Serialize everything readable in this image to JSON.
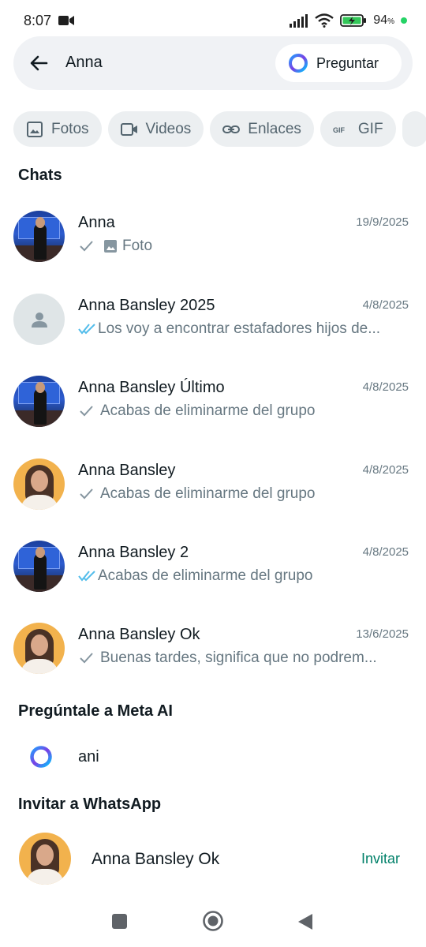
{
  "status_bar": {
    "time": "8:07",
    "battery_percent": "94",
    "battery_unit": "%"
  },
  "search": {
    "query": "Anna",
    "ask_button": "Preguntar"
  },
  "filters": [
    {
      "label": "Fotos",
      "icon": "photo-icon"
    },
    {
      "label": "Videos",
      "icon": "video-icon"
    },
    {
      "label": "Enlaces",
      "icon": "link-icon"
    },
    {
      "label": "GIF",
      "icon": "gif-icon"
    }
  ],
  "chats_section": {
    "title": "Chats",
    "items": [
      {
        "name": "Anna",
        "date": "19/9/2025",
        "preview": "Foto",
        "tick": "single",
        "avatar": "stage",
        "media_icon": "photo-icon"
      },
      {
        "name": "Anna Bansley 2025",
        "date": "4/8/2025",
        "preview": "Los voy a encontrar estafadores hijos de...",
        "tick": "double-blue",
        "avatar": "default"
      },
      {
        "name": "Anna Bansley Último",
        "date": "4/8/2025",
        "preview": "Acabas de eliminarme del grupo",
        "tick": "single",
        "avatar": "stage"
      },
      {
        "name": "Anna Bansley",
        "date": "4/8/2025",
        "preview": "Acabas de eliminarme del grupo",
        "tick": "single",
        "avatar": "portrait"
      },
      {
        "name": "Anna Bansley 2",
        "date": "4/8/2025",
        "preview": "Acabas de eliminarme del grupo",
        "tick": "double-blue",
        "avatar": "stage"
      },
      {
        "name": "Anna Bansley Ok",
        "date": "13/6/2025",
        "preview": "Buenas tardes, significa que no podrem...",
        "tick": "single",
        "avatar": "portrait"
      }
    ]
  },
  "meta_ai_section": {
    "title": "Pregúntale a Meta AI",
    "suggestion": "ani"
  },
  "invite_section": {
    "title": "Invitar a WhatsApp",
    "contact_name": "Anna Bansley Ok",
    "invite_button": "Invitar"
  },
  "colors": {
    "accent_green": "#008069",
    "read_blue": "#53bdeb",
    "secondary_text": "#667781"
  }
}
